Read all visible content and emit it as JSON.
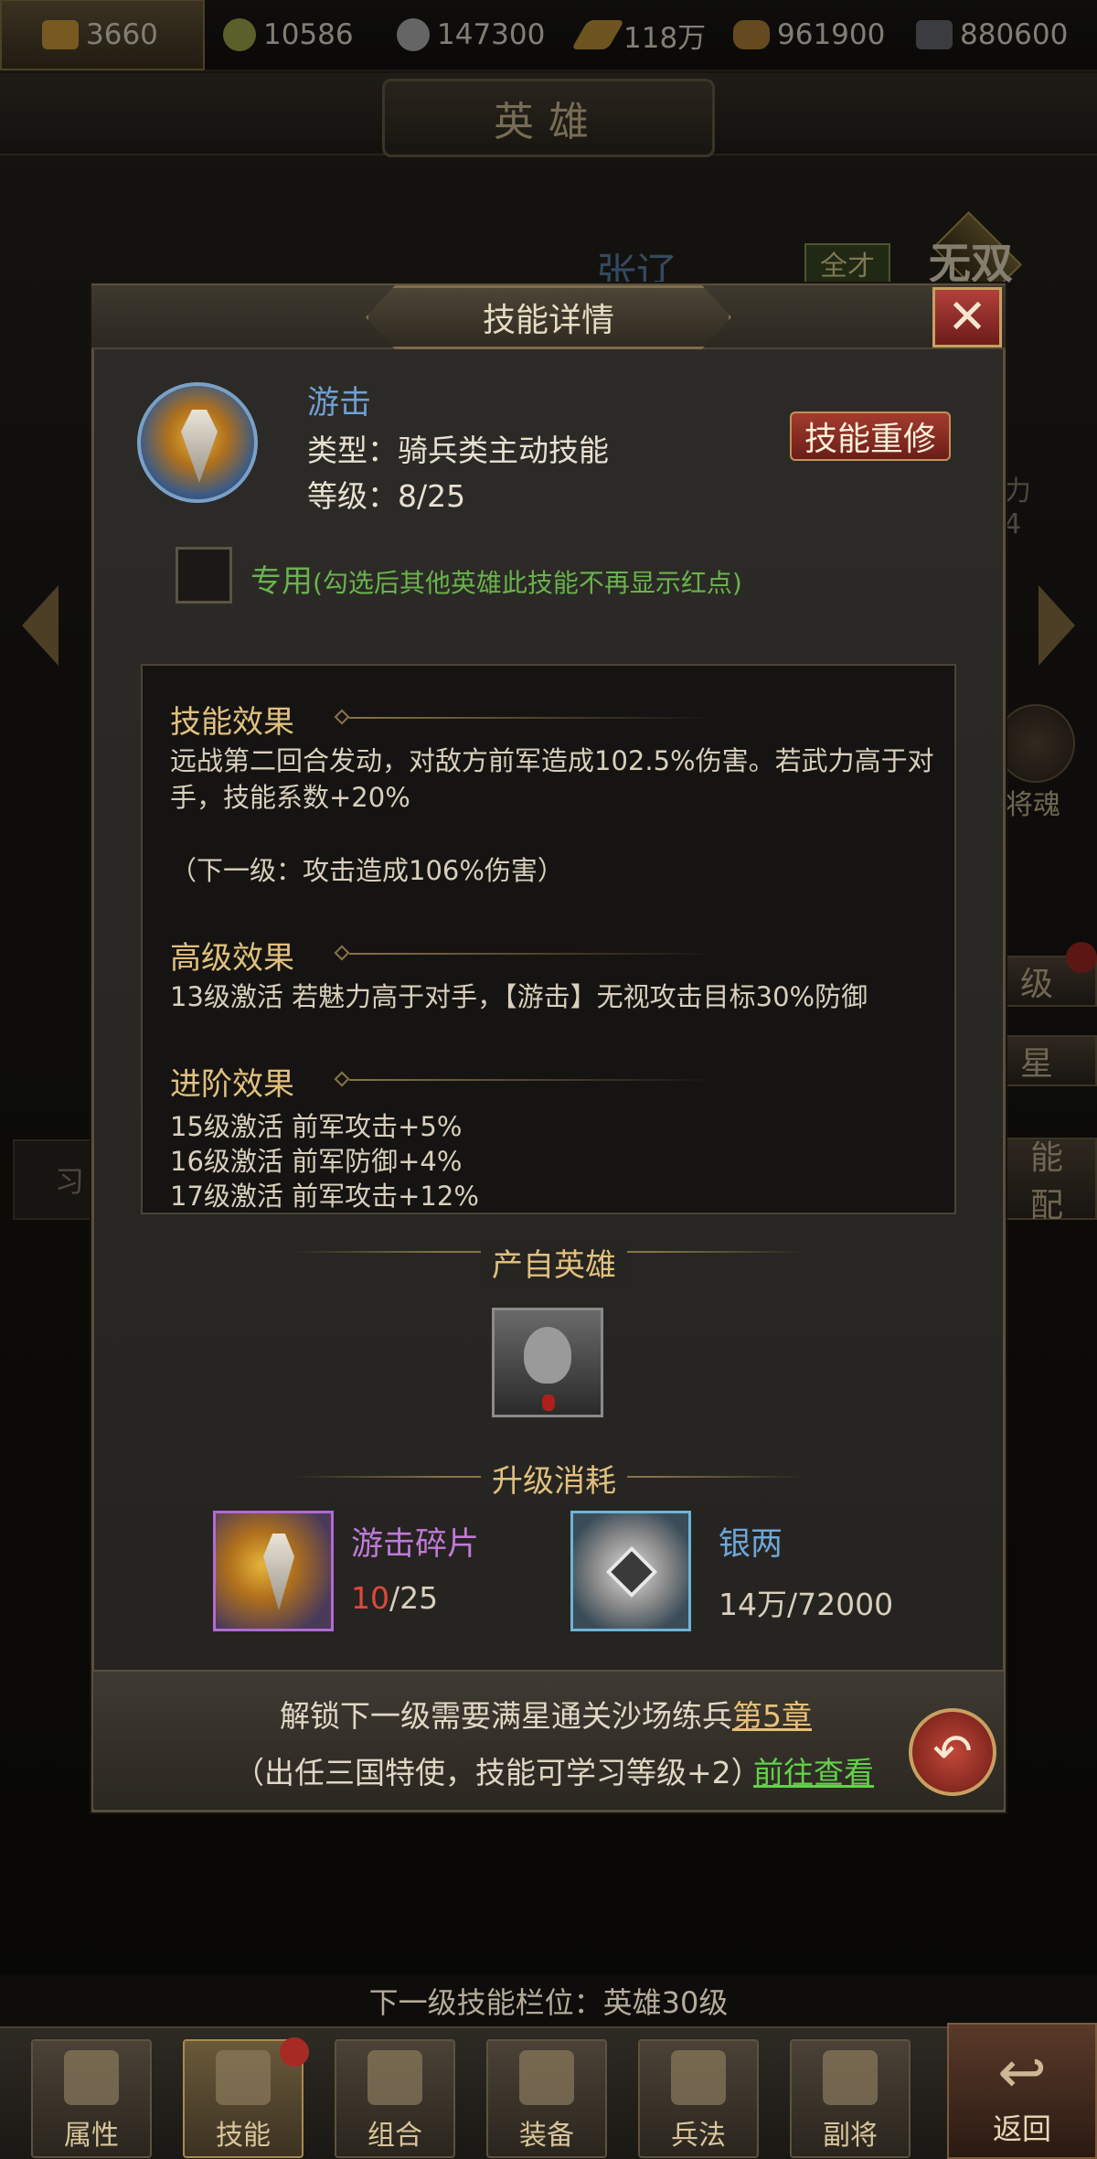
{
  "resources": [
    {
      "icon": "gold-ingot-icon",
      "value": "3660"
    },
    {
      "icon": "jade-coin-icon",
      "value": "10586"
    },
    {
      "icon": "silver-coin-icon",
      "value": "147300"
    },
    {
      "icon": "grain-icon",
      "value": "118万"
    },
    {
      "icon": "wood-icon",
      "value": "961900"
    },
    {
      "icon": "iron-icon",
      "value": "880600"
    }
  ],
  "page_title": "英雄",
  "background": {
    "hero_name": "张辽",
    "badge": "全才",
    "wushuang": "无双",
    "power_label": "力",
    "power_value": "4",
    "soul_label": "将魂",
    "side_level": "级",
    "side_star": "星",
    "side_match_1": "能",
    "side_match_2": "配",
    "learn_tab": "习"
  },
  "dialog": {
    "title": "技能详情",
    "close": "✕",
    "skill_name": "游击",
    "skill_type": "类型：骑兵类主动技能",
    "skill_level": "等级：8/25",
    "reset_button": "技能重修",
    "exclusive_label": "专用",
    "exclusive_note": "(勾选后其他英雄此技能不再显示红点)",
    "sections": {
      "effect_title": "技能效果",
      "effect_text": "远战第二回合发动，对敌方前军造成102.5%伤害。若武力高于对手，技能系数+20%",
      "effect_next": "（下一级：攻击造成106%伤害）",
      "advanced_title": "高级效果",
      "advanced_text": "13级激活 若魅力高于对手，【游击】无视攻击目标30%防御",
      "promotion_title": "进阶效果",
      "promotion_lines": [
        "15级激活 前军攻击+5%",
        "16级激活 前军防御+4%",
        "17级激活 前军攻击+12%"
      ]
    },
    "source_title": "产自英雄",
    "upgrade_title": "升级消耗",
    "materials": [
      {
        "name": "游击碎片",
        "have": "10",
        "need": "/25",
        "have_color": "#e0483a"
      },
      {
        "name": "银两",
        "have": "14万",
        "need": "/72000"
      }
    ],
    "footer_line1_prefix": "解锁下一级需要满星通关沙场练兵",
    "footer_line1_link": "第5章",
    "footer_line2": "（出任三国特使，技能可学习等级+2）",
    "footer_go": "前往查看"
  },
  "next_slot": "下一级技能栏位：英雄30级",
  "nav": [
    {
      "label": "属性",
      "icon": "attribute-icon"
    },
    {
      "label": "技能",
      "icon": "skill-icon",
      "active": true
    },
    {
      "label": "组合",
      "icon": "combo-icon"
    },
    {
      "label": "装备",
      "icon": "equipment-icon"
    },
    {
      "label": "兵法",
      "icon": "tactics-icon"
    },
    {
      "label": "副将",
      "icon": "deputy-icon"
    }
  ],
  "return_label": "返回"
}
